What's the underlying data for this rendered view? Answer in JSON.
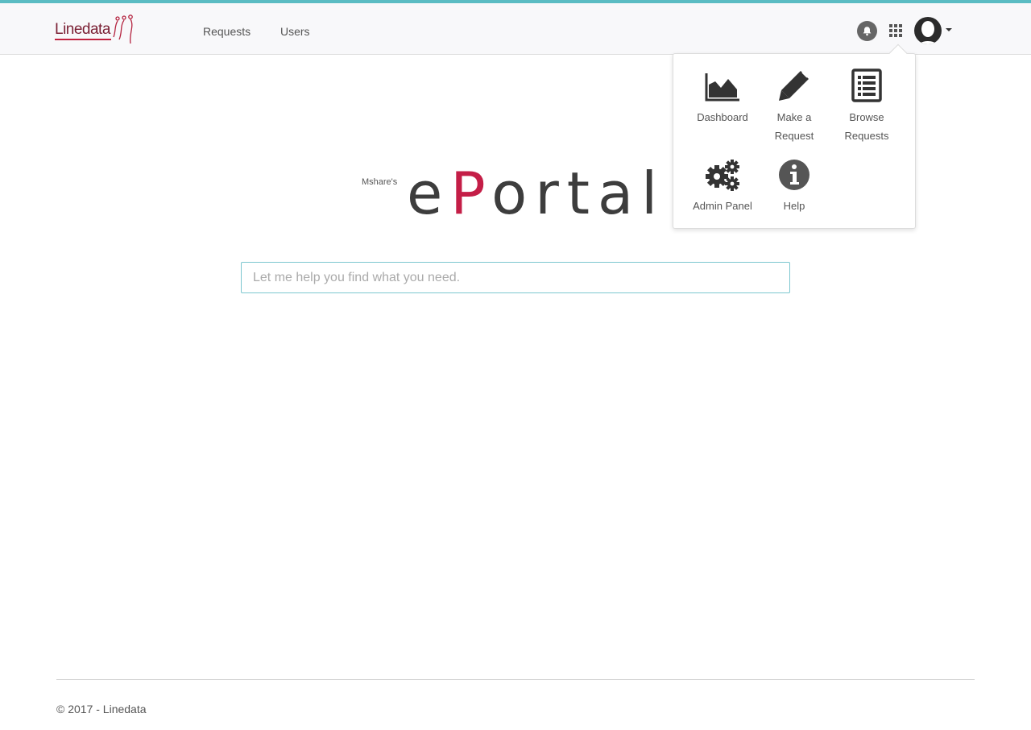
{
  "colors": {
    "accent_teal": "#5bbcc3",
    "brand_red": "#c41e47",
    "text_dark": "#3d3d3d"
  },
  "header": {
    "logo_text": "Linedata",
    "nav": [
      {
        "label": "Requests"
      },
      {
        "label": "Users"
      }
    ],
    "icons": [
      "bell-icon",
      "apps-grid-icon",
      "user-avatar-icon"
    ]
  },
  "app_menu": {
    "items": [
      {
        "label": "Dashboard",
        "icon": "area-chart-icon"
      },
      {
        "label": "Make a Request",
        "icon": "pencil-icon"
      },
      {
        "label": "Browse Requests",
        "icon": "list-icon"
      },
      {
        "label": "Admin Panel",
        "icon": "gears-icon"
      },
      {
        "label": "Help",
        "icon": "info-icon"
      }
    ]
  },
  "brand": {
    "owner": "Mshare's",
    "name_first": "e",
    "name_accent": "P",
    "name_rest": "ortal"
  },
  "search": {
    "placeholder": "Let me help you find what you need.",
    "value": ""
  },
  "footer": {
    "copyright": "© 2017 - Linedata"
  }
}
